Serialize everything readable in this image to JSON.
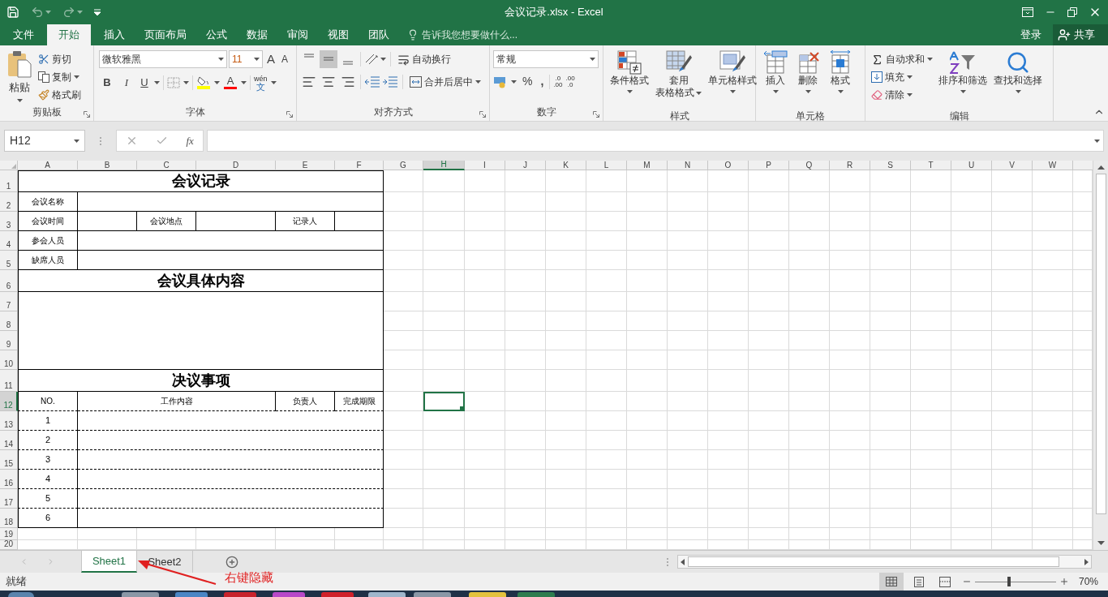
{
  "window": {
    "title": "会议记录.xlsx - Excel"
  },
  "menu": {
    "tabs": [
      {
        "label": "文件",
        "selected": false
      },
      {
        "label": "开始",
        "selected": true
      },
      {
        "label": "插入",
        "selected": false
      },
      {
        "label": "页面布局",
        "selected": false
      },
      {
        "label": "公式",
        "selected": false
      },
      {
        "label": "数据",
        "selected": false
      },
      {
        "label": "审阅",
        "selected": false
      },
      {
        "label": "视图",
        "selected": false
      },
      {
        "label": "团队",
        "selected": false
      }
    ],
    "tell_me": {
      "placeholder": "告诉我您想要做什么..."
    },
    "sign_in": "登录",
    "share": "共享"
  },
  "ribbon": {
    "clipboard": {
      "label": "剪贴板",
      "paste": "粘贴",
      "cut": "剪切",
      "copy": "复制",
      "format_painter": "格式刷"
    },
    "font": {
      "label": "字体",
      "font_name": "微软雅黑",
      "font_size": "11",
      "grow": "A",
      "shrink": "A",
      "bold": "B",
      "italic": "I",
      "underline": "U",
      "font_color": "A",
      "phonetic": "wén",
      "phonetic_char": "文"
    },
    "alignment": {
      "label": "对齐方式",
      "vertical_align": [
        {
          "selected": false
        },
        {
          "selected": true
        },
        {
          "selected": false
        }
      ],
      "wrap": "自动换行",
      "merge": "合并后居中"
    },
    "number": {
      "label": "数字",
      "format": "常规",
      "percent": "%",
      "comma": ",",
      "increase_decimal": [
        ".0",
        ".00"
      ],
      "decrease_decimal": [
        ".00",
        ".0"
      ]
    },
    "styles": {
      "label": "样式",
      "conditional": "条件格式",
      "table": [
        "套用",
        "表格格式"
      ],
      "cell_styles": "单元格样式"
    },
    "cells": {
      "label": "单元格",
      "insert": "插入",
      "delete": "删除",
      "format": "格式"
    },
    "editing": {
      "label": "编辑",
      "autosum": "自动求和",
      "fill": "填充",
      "clear": "清除",
      "sort": "排序和筛选",
      "find": "查找和选择"
    }
  },
  "formula_bar": {
    "name_box": "H12",
    "fx": "fx"
  },
  "sheet": {
    "columns": [
      {
        "label": "A",
        "selected": false
      },
      {
        "label": "B",
        "selected": false
      },
      {
        "label": "C",
        "selected": false
      },
      {
        "label": "D",
        "selected": false
      },
      {
        "label": "E",
        "selected": false
      },
      {
        "label": "F",
        "selected": false
      },
      {
        "label": "G",
        "selected": false
      },
      {
        "label": "H",
        "selected": true
      },
      {
        "label": "I",
        "selected": false
      },
      {
        "label": "J",
        "selected": false
      },
      {
        "label": "K",
        "selected": false
      },
      {
        "label": "L",
        "selected": false
      },
      {
        "label": "M",
        "selected": false
      },
      {
        "label": "N",
        "selected": false
      },
      {
        "label": "O",
        "selected": false
      },
      {
        "label": "P",
        "selected": false
      },
      {
        "label": "Q",
        "selected": false
      },
      {
        "label": "R",
        "selected": false
      },
      {
        "label": "S",
        "selected": false
      },
      {
        "label": "T",
        "selected": false
      },
      {
        "label": "U",
        "selected": false
      },
      {
        "label": "V",
        "selected": false
      },
      {
        "label": "W",
        "selected": false
      }
    ],
    "rows": [
      {
        "label": "1",
        "selected": false
      },
      {
        "label": "2",
        "selected": false
      },
      {
        "label": "3",
        "selected": false
      },
      {
        "label": "4",
        "selected": false
      },
      {
        "label": "5",
        "selected": false
      },
      {
        "label": "6",
        "selected": false
      },
      {
        "label": "7",
        "selected": false
      },
      {
        "label": "8",
        "selected": false
      },
      {
        "label": "9",
        "selected": false
      },
      {
        "label": "10",
        "selected": false
      },
      {
        "label": "11",
        "selected": false
      },
      {
        "label": "12",
        "selected": true
      },
      {
        "label": "13",
        "selected": false
      },
      {
        "label": "14",
        "selected": false
      },
      {
        "label": "15",
        "selected": false
      },
      {
        "label": "16",
        "selected": false
      },
      {
        "label": "17",
        "selected": false
      },
      {
        "label": "18",
        "selected": false
      },
      {
        "label": "19",
        "selected": false
      },
      {
        "label": "20",
        "selected": false
      }
    ],
    "form": {
      "title": "会议记录",
      "labels": [
        "会议名称",
        "会议时间",
        "会议地点",
        "记录人",
        "参会人员",
        "缺席人员"
      ],
      "content_heading": "会议具体内容",
      "decisions_heading": "决议事项",
      "decision_columns": [
        "NO.",
        "工作内容",
        "负责人",
        "完成期限"
      ],
      "decision_rows": [
        "1",
        "2",
        "3",
        "4",
        "5",
        "6"
      ]
    }
  },
  "sheet_tabs": [
    {
      "label": "Sheet1",
      "selected": true
    },
    {
      "label": "Sheet2",
      "selected": false
    }
  ],
  "annotation": "右键隐藏",
  "status_bar": {
    "status": "就绪",
    "zoom": {
      "level": 0.42
    },
    "zoom_reading": "70%"
  }
}
